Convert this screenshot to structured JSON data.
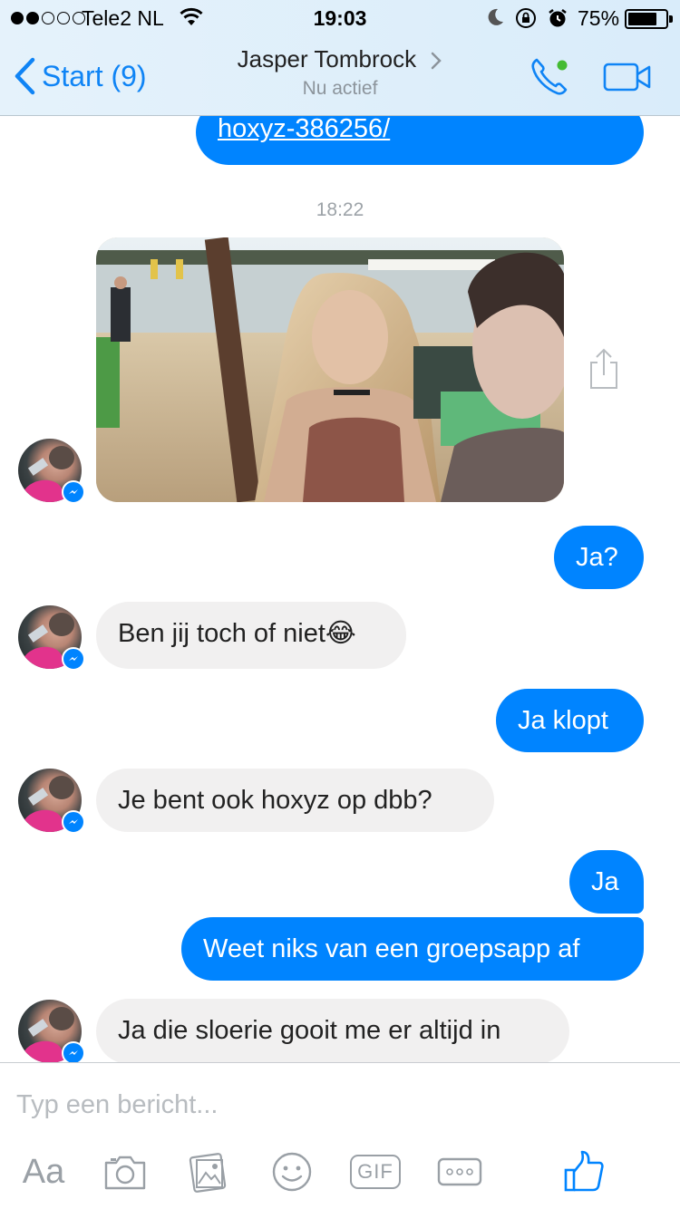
{
  "status_bar": {
    "carrier": "Tele2 NL",
    "time": "19:03",
    "battery_pct": "75%",
    "battery_level": 0.75,
    "signal_bars": 2
  },
  "header": {
    "back_label": "Start (9)",
    "contact_name": "Jasper Tombrock",
    "contact_status": "Nu actief",
    "online_dot_color": "#44bb33"
  },
  "colors": {
    "accent": "#0084ff",
    "incoming_bubble": "#f1f0f0",
    "header_bg": "#dcedfa"
  },
  "messages": [
    {
      "type": "outgoing-link",
      "text": "hoxyz-386256/"
    },
    {
      "type": "timestamp",
      "text": "18:22"
    },
    {
      "type": "incoming-photo",
      "alt": "selfie"
    },
    {
      "type": "outgoing",
      "text": "Ja?"
    },
    {
      "type": "incoming",
      "text": "Ben jij toch of niet😂"
    },
    {
      "type": "outgoing",
      "text": "Ja klopt"
    },
    {
      "type": "incoming",
      "text": "Je bent ook hoxyz op dbb?"
    },
    {
      "type": "outgoing",
      "text": "Ja"
    },
    {
      "type": "outgoing",
      "text": "Weet niks van een groepsapp af"
    },
    {
      "type": "incoming",
      "text": "Ja die sloerie gooit me er altijd in"
    }
  ],
  "composer": {
    "placeholder": "Typ een bericht...",
    "aa_label": "Aa",
    "gif_label": "GIF",
    "tools": [
      "text-format-icon",
      "camera-icon",
      "gallery-icon",
      "emoji-icon",
      "gif-icon",
      "more-icon",
      "like-icon"
    ]
  }
}
